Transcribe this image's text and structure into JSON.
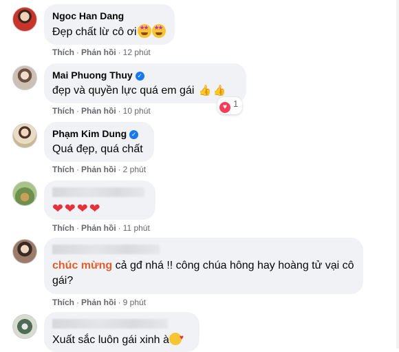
{
  "comments": [
    {
      "name": "Ngoc Han Dang",
      "text": "Đẹp chất lừ cô ơi",
      "time": "12 phút",
      "avatar_color": "#c9342b"
    },
    {
      "name": "Mai Phuong Thuy",
      "verified": true,
      "text": "đẹp và quyền lực quá em gái",
      "time": "10 phút",
      "reaction_count": "1",
      "avatar_color": "#b9a79a"
    },
    {
      "name": "Phạm Kim Dung",
      "verified": true,
      "text": "Quá đẹp, quá chất",
      "time": "2 phút",
      "avatar_color": "#d7c6a7"
    },
    {
      "name": "",
      "name_hidden": true,
      "text": "",
      "hearts": 4,
      "time": "11 phút",
      "avatar_color": "#6f8f4c"
    },
    {
      "name": "",
      "name_hidden": true,
      "text_highlight": "chúc mừng",
      "text": " cả gđ nhá !! công chúa hông hay hoàng tử vại cô gái?",
      "time": "9 phút",
      "avatar_color": "#7d5a47"
    },
    {
      "name": "",
      "name_hidden": true,
      "text": "Xuất sắc luôn gái xinh à",
      "time": "",
      "avatar_color": "#4f6a57"
    }
  ],
  "actions": {
    "like": "Thích",
    "reply": "Phản hồi",
    "separator": "·"
  }
}
